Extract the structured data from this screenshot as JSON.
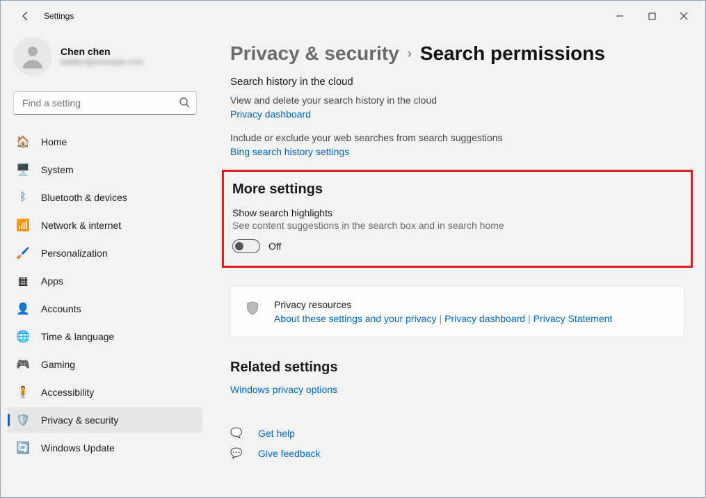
{
  "window": {
    "title": "Settings"
  },
  "profile": {
    "name": "Chen chen",
    "email": "hidden@example.com"
  },
  "search": {
    "placeholder": "Find a setting"
  },
  "sidebar": {
    "items": [
      {
        "label": "Home"
      },
      {
        "label": "System"
      },
      {
        "label": "Bluetooth & devices"
      },
      {
        "label": "Network & internet"
      },
      {
        "label": "Personalization"
      },
      {
        "label": "Apps"
      },
      {
        "label": "Accounts"
      },
      {
        "label": "Time & language"
      },
      {
        "label": "Gaming"
      },
      {
        "label": "Accessibility"
      },
      {
        "label": "Privacy & security"
      },
      {
        "label": "Windows Update"
      }
    ]
  },
  "breadcrumb": {
    "parent": "Privacy & security",
    "current": "Search permissions"
  },
  "cloud": {
    "title": "Search history in the cloud",
    "desc1": "View and delete your search history in the cloud",
    "link1": "Privacy dashboard",
    "desc2": "Include or exclude your web searches from search suggestions",
    "link2": "Bing search history settings"
  },
  "more": {
    "title": "More settings",
    "label": "Show search highlights",
    "desc": "See content suggestions in the search box and in search home",
    "state": "Off"
  },
  "resources": {
    "title": "Privacy resources",
    "link1": "About these settings and your privacy",
    "link2": "Privacy dashboard",
    "link3": "Privacy Statement"
  },
  "related": {
    "title": "Related settings",
    "link": "Windows privacy options"
  },
  "help": {
    "get_help": "Get help",
    "give_feedback": "Give feedback"
  }
}
